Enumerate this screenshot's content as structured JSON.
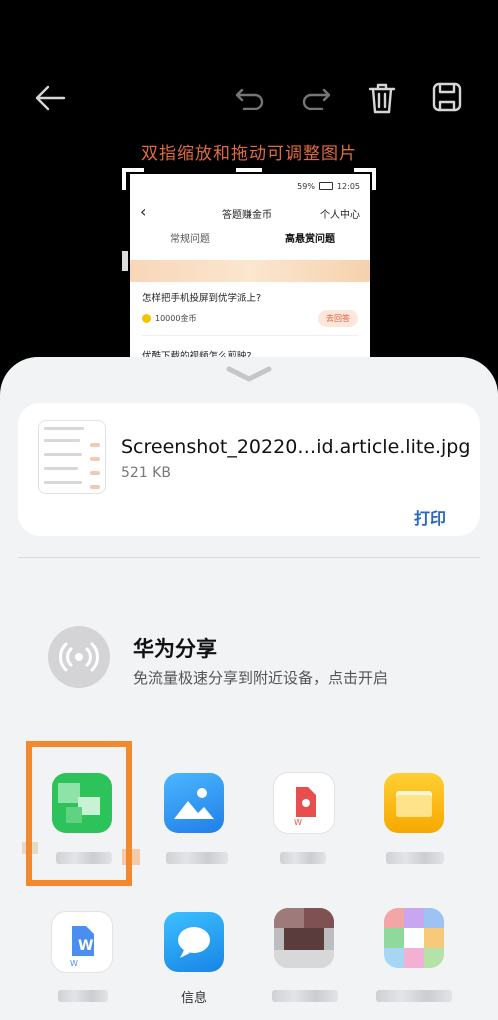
{
  "editor": {
    "hint": "双指缩放和拖动可调整图片",
    "toolbar": [
      "back-icon",
      "undo-icon",
      "redo-icon",
      "delete-icon",
      "save-icon"
    ]
  },
  "preview": {
    "status_battery": "59%",
    "status_time": "12:05",
    "nav_title": "答题赚金币",
    "nav_right": "个人中心",
    "tab_left": "常规问题",
    "tab_right": "高悬赏问题",
    "question1": "怎样把手机投屏到优学派上?",
    "coins": "10000金币",
    "answer_btn": "去回答",
    "question2": "优酷下载的视频怎么剪映?"
  },
  "file": {
    "name": "Screenshot_20220…id.article.lite.jpg",
    "size": "521 KB",
    "print_label": "打印"
  },
  "huawei_share": {
    "title": "华为分享",
    "subtitle": "免流量极速分享到附近设备，点击开启"
  },
  "apps": [
    {
      "icon": "wechat-icon",
      "label": ""
    },
    {
      "icon": "gallery-icon",
      "label": ""
    },
    {
      "icon": "pdf-icon",
      "label": ""
    },
    {
      "icon": "files-icon",
      "label": ""
    },
    {
      "icon": "wps-word-icon",
      "label": ""
    },
    {
      "icon": "messages-icon",
      "label": "信息"
    },
    {
      "icon": "app-icon",
      "label": ""
    },
    {
      "icon": "app-icon",
      "label": ""
    }
  ],
  "colors": {
    "accent": "#2a66c4",
    "highlight": "#f2892f",
    "hint": "#e06b3e"
  }
}
